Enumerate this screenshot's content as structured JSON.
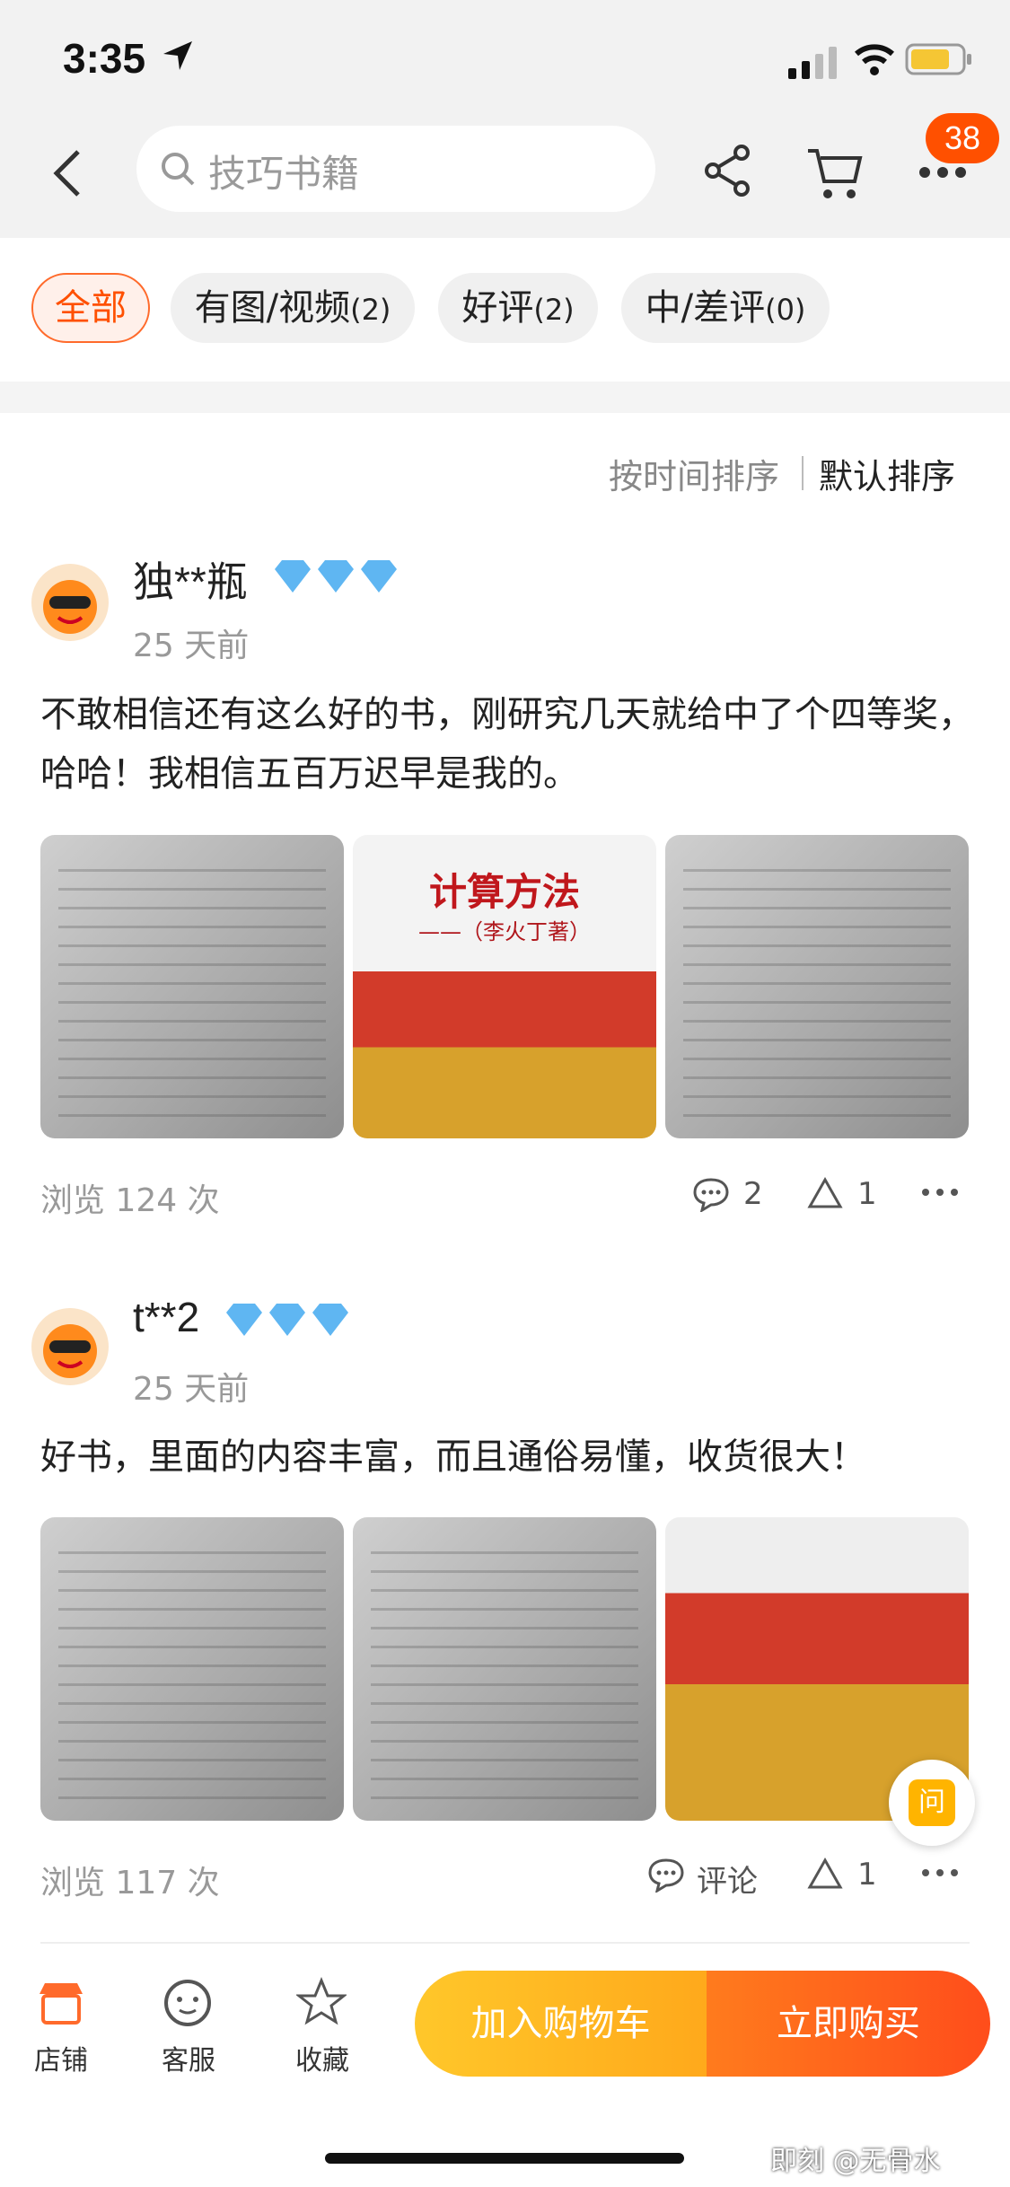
{
  "status": {
    "time": "3:35"
  },
  "search": {
    "placeholder": "技巧书籍"
  },
  "nav": {
    "more_badge": "38"
  },
  "filters": [
    {
      "label": "全部",
      "count": ""
    },
    {
      "label": "有图/视频",
      "count": "(2)"
    },
    {
      "label": "好评",
      "count": "(2)"
    },
    {
      "label": "中/差评",
      "count": "(0)"
    }
  ],
  "sort": {
    "by_time": "按时间排序",
    "default": "默认排序"
  },
  "reviews": [
    {
      "user": "独**瓶",
      "date": "25 天前",
      "text": "不敢相信还有这么好的书，刚研究几天就给中了个四等奖，哈哈！我相信五百万迟早是我的。",
      "views": "浏览 124 次",
      "comments": "2",
      "likes": "1",
      "cover_title": "计算方法",
      "cover_author": "——（李火丁著）"
    },
    {
      "user": "t**2",
      "date": "25 天前",
      "text": "好书，里面的内容丰富，而且通俗易懂，收货很大！",
      "views": "浏览 117 次",
      "comments": "评论",
      "likes": "1"
    }
  ],
  "bottom": {
    "shop": "店铺",
    "service": "客服",
    "favorite": "收藏",
    "add_to_cart": "加入购物车",
    "buy_now": "立即购买"
  },
  "ask": "问",
  "watermark": "即刻 @无骨水"
}
